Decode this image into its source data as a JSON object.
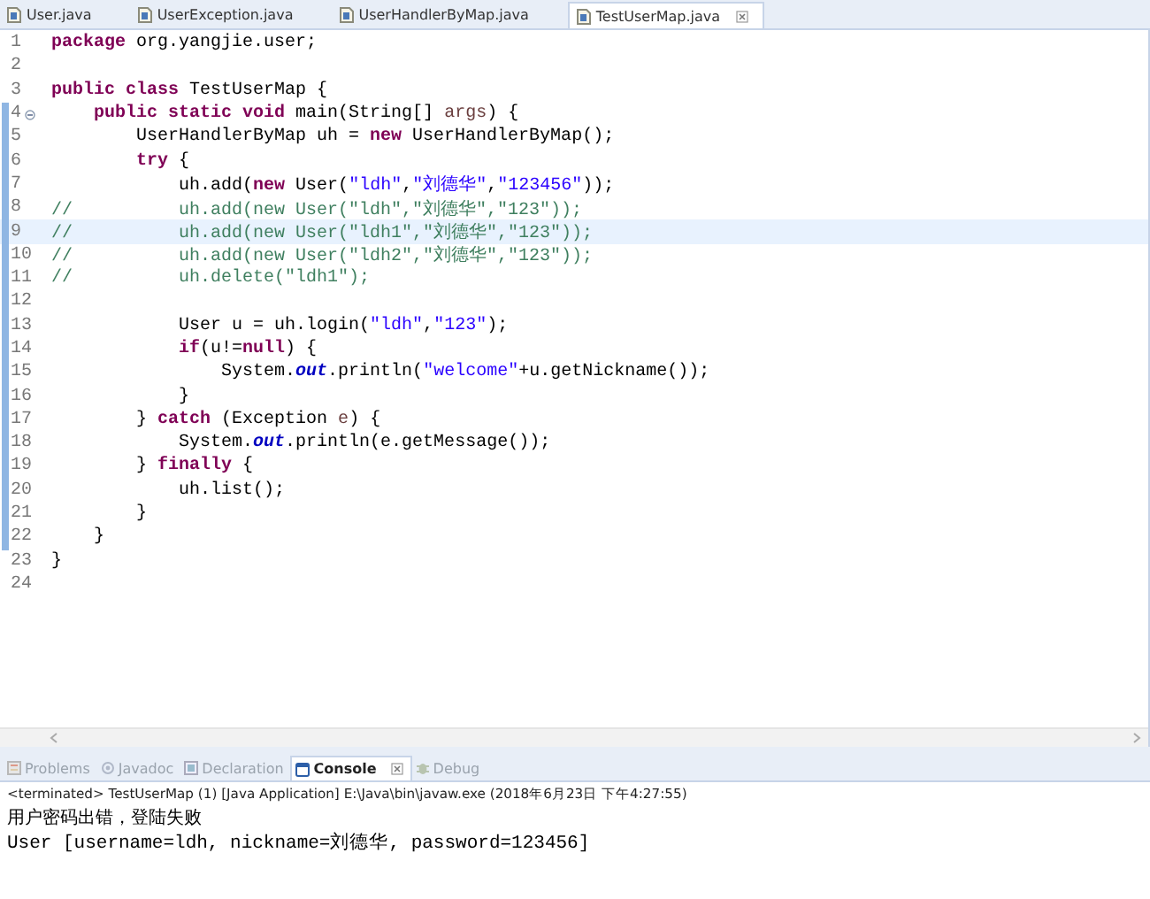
{
  "editor_tabs": [
    {
      "label": "User.java",
      "selected": false
    },
    {
      "label": "UserException.java",
      "selected": false
    },
    {
      "label": "UserHandlerByMap.java",
      "selected": false
    },
    {
      "label": "TestUserMap.java",
      "selected": true
    }
  ],
  "code_lines": [
    {
      "num": "1",
      "changed": false,
      "current": false,
      "fold": false,
      "tokens": [
        {
          "kind": "kw",
          "t": "package"
        },
        {
          "kind": "plain",
          "t": " org.yangjie.user;"
        }
      ]
    },
    {
      "num": "2",
      "changed": false,
      "current": false,
      "fold": false
    },
    {
      "num": "3",
      "changed": false,
      "current": false,
      "fold": false,
      "tokens": [
        {
          "kind": "kw",
          "t": "public "
        },
        {
          "kind": "kw",
          "t": "class"
        },
        {
          "kind": "plain",
          "t": " TestUserMap {"
        }
      ]
    },
    {
      "num": "4",
      "changed": true,
      "current": false,
      "fold": true,
      "tokens": [
        {
          "kind": "kw",
          "t": "    public "
        },
        {
          "kind": "kw",
          "t": "static "
        },
        {
          "kind": "kw",
          "t": "void"
        },
        {
          "kind": "plain",
          "t": " main(String[] "
        },
        {
          "kind": "var",
          "t": "args"
        },
        {
          "kind": "plain",
          "t": ") {"
        }
      ]
    },
    {
      "num": "5",
      "changed": true,
      "current": false,
      "fold": false,
      "tokens": [
        {
          "kind": "plain",
          "t": "        UserHandlerByMap uh = "
        },
        {
          "kind": "kw",
          "t": "new"
        },
        {
          "kind": "plain",
          "t": " UserHandlerByMap();"
        }
      ]
    },
    {
      "num": "6",
      "changed": true,
      "current": false,
      "fold": false,
      "tokens": [
        {
          "kind": "kw",
          "t": "        try"
        },
        {
          "kind": "plain",
          "t": " {"
        }
      ]
    },
    {
      "num": "7",
      "changed": true,
      "current": false,
      "fold": false,
      "tokens": [
        {
          "kind": "plain",
          "t": "            uh.add("
        },
        {
          "kind": "kw",
          "t": "new"
        },
        {
          "kind": "plain",
          "t": " User("
        },
        {
          "kind": "str",
          "t": "\"ldh\""
        },
        {
          "kind": "plain",
          "t": ","
        },
        {
          "kind": "str",
          "t": "\"刘德华\""
        },
        {
          "kind": "plain",
          "t": ","
        },
        {
          "kind": "str",
          "t": "\"123456\""
        },
        {
          "kind": "plain",
          "t": "));"
        }
      ]
    },
    {
      "num": "8",
      "changed": true,
      "current": false,
      "fold": false,
      "tokens": [
        {
          "kind": "com",
          "t": "//          uh.add(new User(\"ldh\",\"刘德华\",\"123\"));"
        }
      ]
    },
    {
      "num": "9",
      "changed": true,
      "current": true,
      "fold": false,
      "tokens": [
        {
          "kind": "com",
          "t": "//          uh.add(new User(\"ldh1\",\"刘德华\",\"123\"));"
        }
      ]
    },
    {
      "num": "10",
      "changed": true,
      "current": false,
      "fold": false,
      "tokens": [
        {
          "kind": "com",
          "t": "//          uh.add(new User(\"ldh2\",\"刘德华\",\"123\"));"
        }
      ]
    },
    {
      "num": "11",
      "changed": true,
      "current": false,
      "fold": false,
      "tokens": [
        {
          "kind": "com",
          "t": "//          uh.delete(\"ldh1\");"
        }
      ]
    },
    {
      "num": "12",
      "changed": true,
      "current": false,
      "fold": false
    },
    {
      "num": "13",
      "changed": true,
      "current": false,
      "fold": false,
      "tokens": [
        {
          "kind": "plain",
          "t": "            User u = uh.login("
        },
        {
          "kind": "str",
          "t": "\"ldh\""
        },
        {
          "kind": "plain",
          "t": ","
        },
        {
          "kind": "str",
          "t": "\"123\""
        },
        {
          "kind": "plain",
          "t": ");"
        }
      ]
    },
    {
      "num": "14",
      "changed": true,
      "current": false,
      "fold": false,
      "tokens": [
        {
          "kind": "kw",
          "t": "            if"
        },
        {
          "kind": "plain",
          "t": "(u!="
        },
        {
          "kind": "kw",
          "t": "null"
        },
        {
          "kind": "plain",
          "t": ") {"
        }
      ]
    },
    {
      "num": "15",
      "changed": true,
      "current": false,
      "fold": false,
      "tokens": [
        {
          "kind": "plain",
          "t": "                System."
        },
        {
          "kind": "field",
          "t": "out"
        },
        {
          "kind": "plain",
          "t": ".println("
        },
        {
          "kind": "str",
          "t": "\"welcome\""
        },
        {
          "kind": "plain",
          "t": "+u.getNickname());"
        }
      ]
    },
    {
      "num": "16",
      "changed": true,
      "current": false,
      "fold": false,
      "tokens": [
        {
          "kind": "plain",
          "t": "            }"
        }
      ]
    },
    {
      "num": "17",
      "changed": true,
      "current": false,
      "fold": false,
      "tokens": [
        {
          "kind": "plain",
          "t": "        } "
        },
        {
          "kind": "kw",
          "t": "catch"
        },
        {
          "kind": "plain",
          "t": " (Exception "
        },
        {
          "kind": "var",
          "t": "e"
        },
        {
          "kind": "plain",
          "t": ") {"
        }
      ]
    },
    {
      "num": "18",
      "changed": true,
      "current": false,
      "fold": false,
      "tokens": [
        {
          "kind": "plain",
          "t": "            System."
        },
        {
          "kind": "field",
          "t": "out"
        },
        {
          "kind": "plain",
          "t": ".println(e.getMessage());"
        }
      ]
    },
    {
      "num": "19",
      "changed": true,
      "current": false,
      "fold": false,
      "tokens": [
        {
          "kind": "plain",
          "t": "        } "
        },
        {
          "kind": "kw",
          "t": "finally"
        },
        {
          "kind": "plain",
          "t": " {"
        }
      ]
    },
    {
      "num": "20",
      "changed": true,
      "current": false,
      "fold": false,
      "tokens": [
        {
          "kind": "plain",
          "t": "            uh.list();"
        }
      ]
    },
    {
      "num": "21",
      "changed": true,
      "current": false,
      "fold": false,
      "tokens": [
        {
          "kind": "plain",
          "t": "        }"
        }
      ]
    },
    {
      "num": "22",
      "changed": true,
      "current": false,
      "fold": false,
      "tokens": [
        {
          "kind": "plain",
          "t": "    }"
        }
      ]
    },
    {
      "num": "23",
      "changed": false,
      "current": false,
      "fold": false,
      "tokens": [
        {
          "kind": "plain",
          "t": "}"
        }
      ]
    },
    {
      "num": "24",
      "changed": false,
      "current": false,
      "fold": false
    }
  ],
  "panel_tabs": [
    {
      "label": "Problems",
      "kind": "problems",
      "selected": false
    },
    {
      "label": "Javadoc",
      "kind": "javadoc",
      "selected": false
    },
    {
      "label": "Declaration",
      "kind": "declaration",
      "selected": false
    },
    {
      "label": "Console",
      "kind": "console",
      "selected": true
    },
    {
      "label": "Debug",
      "kind": "debug",
      "selected": false
    }
  ],
  "console": {
    "header": "<terminated> TestUserMap (1) [Java Application] E:\\Java\\bin\\javaw.exe (2018年6月23日 下午4:27:55)",
    "output": [
      "用户密码出错，登陆失败",
      "User [username=ldh, nickname=刘德华, password=123456]"
    ]
  }
}
